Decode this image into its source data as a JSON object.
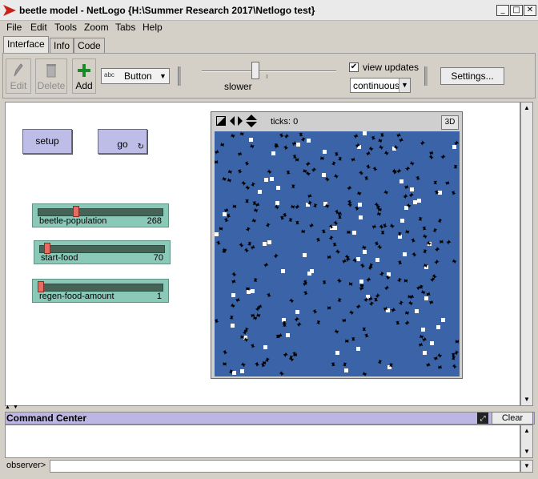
{
  "window": {
    "title": "beetle model - NetLogo {H:\\Summer Research 2017\\Netlogo test}"
  },
  "menu": [
    "File",
    "Edit",
    "Tools",
    "Zoom",
    "Tabs",
    "Help"
  ],
  "tabs": [
    {
      "label": "Interface",
      "active": true
    },
    {
      "label": "Info",
      "active": false
    },
    {
      "label": "Code",
      "active": false
    }
  ],
  "toolbar": {
    "edit_label": "Edit",
    "delete_label": "Delete",
    "add_label": "Add",
    "widget_type": "Button",
    "speed_label": "slower",
    "speed_value": 0.4,
    "view_updates_label": "view updates",
    "view_updates_checked": true,
    "update_mode": "continuous",
    "settings_label": "Settings..."
  },
  "widgets": {
    "setup_label": "setup",
    "go_label": "go",
    "sliders": [
      {
        "name": "beetle-population",
        "value": "268",
        "fraction": 0.29
      },
      {
        "name": "start-food",
        "value": "70",
        "fraction": 0.04
      },
      {
        "name": "regen-food-amount",
        "value": "1",
        "fraction": 0.0
      }
    ]
  },
  "view": {
    "ticks_label": "ticks: 0",
    "btn_3d": "3D"
  },
  "command_center": {
    "title": "Command Center",
    "clear_label": "Clear",
    "observer_label": "observer>"
  },
  "colors": {
    "world": "#3b64a8",
    "button_widget": "#bdbde8",
    "slider_widget": "#8ac8b8",
    "food": "#ffffff",
    "beetle": "#000000"
  }
}
